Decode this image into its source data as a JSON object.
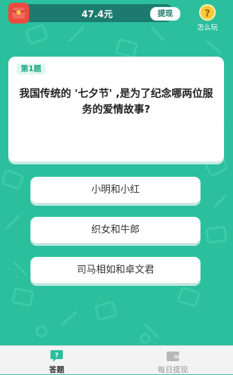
{
  "header": {
    "balance": "47.4元",
    "withdraw_label": "提现",
    "help_label": "怎么玩",
    "help_symbol": "?"
  },
  "question": {
    "badge": "第1题",
    "text": "我国传统的 '七夕节' ,是为了纪念哪两位服务的爱情故事?"
  },
  "options": [
    {
      "label": "小明和小红"
    },
    {
      "label": "织女和牛郎"
    },
    {
      "label": "司马相如和卓文君"
    }
  ],
  "bottom_nav": [
    {
      "label": "答题",
      "icon": "question-bubble-icon",
      "active": true
    },
    {
      "label": "每日提现",
      "icon": "wallet-icon",
      "active": false
    }
  ],
  "colors": {
    "background": "#2bbf9e",
    "balance_pill": "#1c7b6e",
    "wallet_red": "#ef4a3f",
    "help_yellow": "#f8c93a"
  }
}
